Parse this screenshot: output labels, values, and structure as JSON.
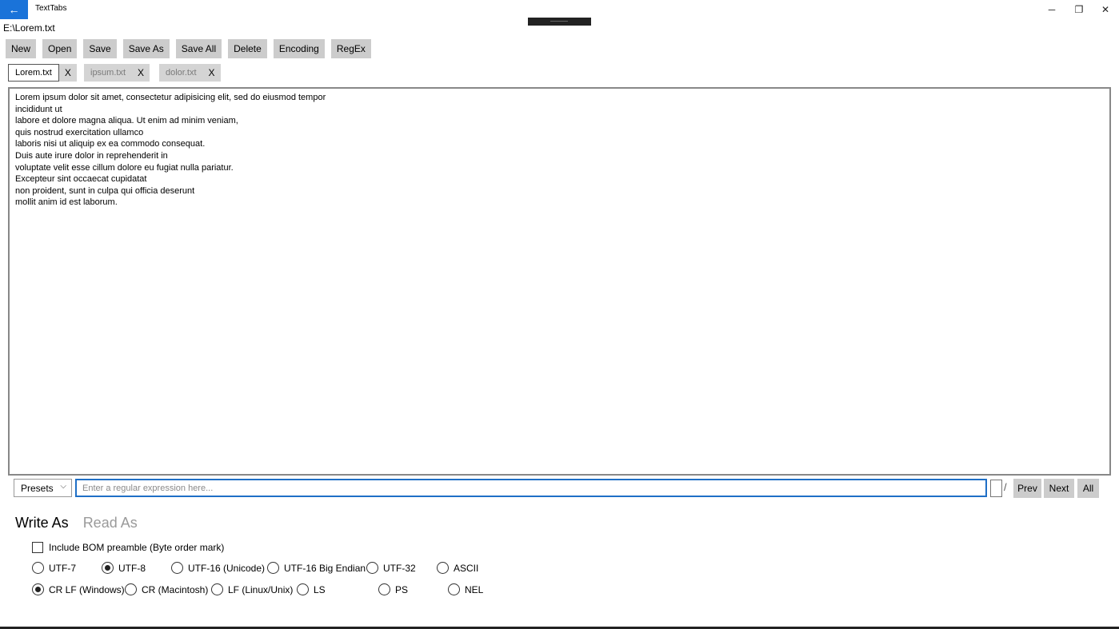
{
  "window": {
    "title": "TextTabs",
    "back_icon": "←",
    "minimize_icon": "─",
    "restore_icon": "❐",
    "close_icon": "✕"
  },
  "path": "E:\\Lorem.txt",
  "toolbar": [
    "New",
    "Open",
    "Save",
    "Save As",
    "Save All",
    "Delete",
    "Encoding",
    "RegEx"
  ],
  "tabs": [
    {
      "label": "Lorem.txt",
      "close": "X",
      "active": true
    },
    {
      "label": "ipsum.txt",
      "close": "X",
      "active": false
    },
    {
      "label": "dolor.txt",
      "close": "X",
      "active": false
    }
  ],
  "editor": {
    "text": "Lorem ipsum dolor sit amet, consectetur adipisicing elit, sed do eiusmod tempor\nincididunt ut\nlabore et dolore magna aliqua. Ut enim ad minim veniam,\nquis nostrud exercitation ullamco\nlaboris nisi ut aliquip ex ea commodo consequat.\nDuis aute irure dolor in reprehenderit in\nvoluptate velit esse cillum dolore eu fugiat nulla pariatur.\nExcepteur sint occaecat cupidatat\nnon proident, sunt in culpa qui officia deserunt\nmollit anim id est laborum."
  },
  "regex": {
    "presets_label": "Presets",
    "chevron_icon": "⌵",
    "placeholder": "Enter a regular expression here...",
    "value": "",
    "flags_value": "",
    "slash": "/",
    "prev_label": "Prev",
    "next_label": "Next",
    "all_label": "All"
  },
  "pivot": {
    "write_as": "Write As",
    "read_as": "Read As",
    "selected": "Write As"
  },
  "encoding": {
    "bom_label": "Include BOM preamble (Byte order mark)",
    "bom_checked": false,
    "encodings": [
      {
        "label": "UTF-7",
        "checked": false
      },
      {
        "label": "UTF-8",
        "checked": true
      },
      {
        "label": "UTF-16 (Unicode)",
        "checked": false
      },
      {
        "label": "UTF-16 Big Endian",
        "checked": false
      },
      {
        "label": "UTF-32",
        "checked": false
      },
      {
        "label": "ASCII",
        "checked": false
      }
    ],
    "line_endings": [
      {
        "label": "CR LF (Windows)",
        "checked": true
      },
      {
        "label": "CR (Macintosh)",
        "checked": false
      },
      {
        "label": "LF (Linux/Unix)",
        "checked": false
      },
      {
        "label": "LS",
        "checked": false
      },
      {
        "label": "PS",
        "checked": false
      },
      {
        "label": "NEL",
        "checked": false
      }
    ]
  },
  "colors": {
    "accent": "#1a73d9",
    "button_bg": "#cccccc",
    "input_focus_border": "#1f6fc6"
  }
}
